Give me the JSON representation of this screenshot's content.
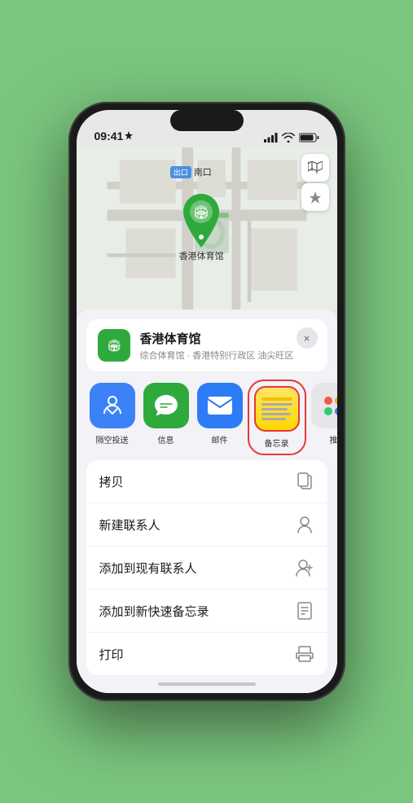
{
  "status": {
    "time": "09:41",
    "location_arrow": true
  },
  "map": {
    "south_gate_tag": "出口",
    "south_gate_label": "南口",
    "marker_label": "香港体育馆"
  },
  "venue_card": {
    "name": "香港体育馆",
    "description": "综合体育馆 · 香港特别行政区 油尖旺区",
    "close_label": "×"
  },
  "share_items": [
    {
      "id": "airdrop",
      "label": "隔空投送",
      "icon": "airdrop"
    },
    {
      "id": "message",
      "label": "信息",
      "icon": "message"
    },
    {
      "id": "mail",
      "label": "邮件",
      "icon": "mail"
    },
    {
      "id": "notes",
      "label": "备忘录",
      "icon": "notes"
    },
    {
      "id": "more",
      "label": "推",
      "icon": "more"
    }
  ],
  "actions": [
    {
      "id": "copy",
      "label": "拷贝",
      "icon": "copy"
    },
    {
      "id": "new-contact",
      "label": "新建联系人",
      "icon": "person"
    },
    {
      "id": "add-existing",
      "label": "添加到现有联系人",
      "icon": "person-plus"
    },
    {
      "id": "add-note",
      "label": "添加到新快速备忘录",
      "icon": "note"
    },
    {
      "id": "print",
      "label": "打印",
      "icon": "print"
    }
  ]
}
